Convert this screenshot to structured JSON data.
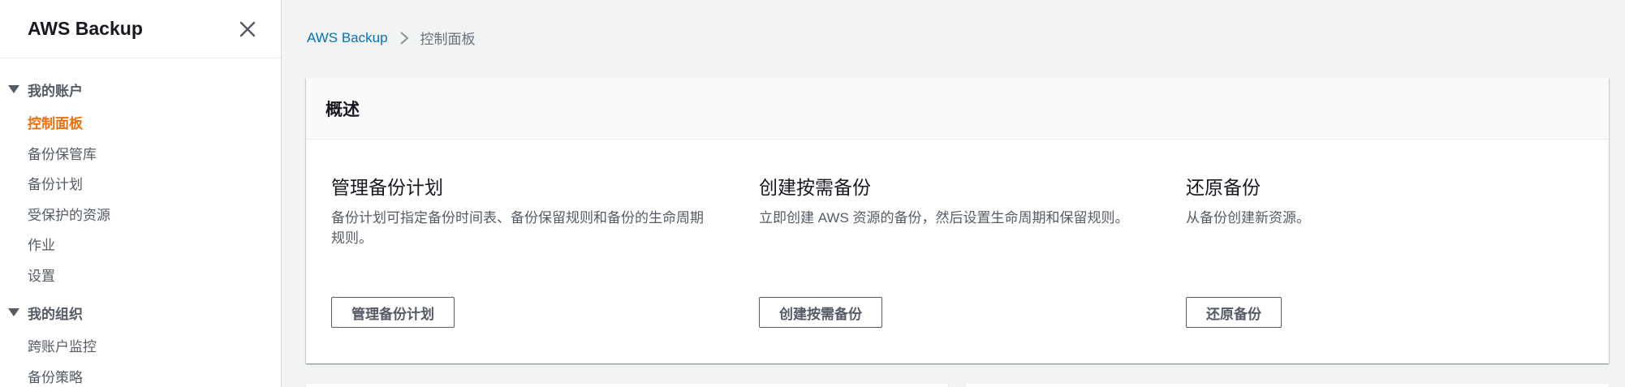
{
  "sidebar": {
    "title": "AWS Backup",
    "groups": [
      {
        "label": "我的账户",
        "items": [
          {
            "label": "控制面板",
            "active": true
          },
          {
            "label": "备份保管库"
          },
          {
            "label": "备份计划"
          },
          {
            "label": "受保护的资源"
          },
          {
            "label": "作业"
          },
          {
            "label": "设置"
          }
        ]
      },
      {
        "label": "我的组织",
        "items": [
          {
            "label": "跨账户监控"
          },
          {
            "label": "备份策略"
          }
        ]
      }
    ]
  },
  "breadcrumb": {
    "root": "AWS Backup",
    "current": "控制面板"
  },
  "overview": {
    "title": "概述",
    "columns": [
      {
        "title": "管理备份计划",
        "desc": "备份计划可指定备份时间表、备份保留规则和备份的生命周期规则。",
        "button": "管理备份计划"
      },
      {
        "title": "创建按需备份",
        "desc": "立即创建 AWS 资源的备份，然后设置生命周期和保留规则。",
        "button": "创建按需备份"
      },
      {
        "title": "还原备份",
        "desc": "从备份创建新资源。",
        "button": "还原备份"
      }
    ]
  },
  "colors": {
    "accent": "#ec7211",
    "link": "#0073bb"
  }
}
